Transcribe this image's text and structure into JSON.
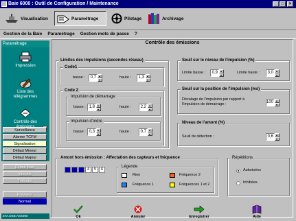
{
  "window": {
    "title": "Baie 6000 : Outil de Configuration / Maintenance"
  },
  "toolbar": {
    "visualisation": "Visualisation",
    "parametrage": "Paramétrage",
    "pilotage": "Pilotage",
    "archivage": "Archivage"
  },
  "menu": {
    "items": [
      "Gestion de la Baie",
      "Paramétrage",
      "Gestion mots de passe",
      "?"
    ]
  },
  "sidebar": {
    "header": "Paramétrage",
    "items": [
      {
        "label": "Impression"
      },
      {
        "label": "Liste des télégrammes"
      },
      {
        "label": "Contrôle des émissions"
      }
    ],
    "buttons": [
      {
        "label": "Surveillance"
      },
      {
        "label": "Alarme TCFM"
      },
      {
        "label": "Signalisation"
      },
      {
        "label": "Défaut Mineur"
      },
      {
        "label": "Défaut Majeur"
      },
      {
        "label": "Défaut Baie"
      },
      {
        "label": "Interdits"
      },
      {
        "label": "Télépilot"
      },
      {
        "label": "Prévision"
      },
      {
        "label": "Normal"
      }
    ],
    "status": "ZTA.DEB.ASS000"
  },
  "main": {
    "title": "Contrôle des émissions",
    "limites": {
      "title": "Limites des impulsions  (secondes réseau)",
      "code1": {
        "title": "Code1",
        "basse_label": "basse :",
        "basse": "0,7",
        "haute_label": "haute :",
        "haute": "1,3"
      },
      "code2": {
        "title": "Code 2",
        "demarrage": {
          "title": "Impulsion de démarrage",
          "basse_label": "basse :",
          "basse": "1,8",
          "haute_label": "haute :",
          "haute": "2,2"
        },
        "ordre": {
          "title": "Impulsion d'ordre",
          "basse_label": "basse :",
          "basse": "0,3",
          "haute_label": "haute :",
          "haute": "0,7"
        }
      }
    },
    "seuil_niveau": {
      "title": "Seuil sur le niveau de l'impulsion  (%)",
      "basse_label": "Limite basse :",
      "basse": "0,9",
      "haute_label": "Limite haute :",
      "haute": "3,0"
    },
    "seuil_position": {
      "title": "Seuil sur la position de l'impulsion (ms)",
      "label": "Décalage de l'impulsion par rapport à l'impulsion de démarrage :",
      "value": "100"
    },
    "niveau_amont": {
      "title": "Niveau de l'amont (%)",
      "label": "Seuil de détection :",
      "value": "0,6"
    },
    "amont": {
      "title": "Amont hors émission : Affectation des capteurs et fréquence",
      "boxes": [
        "1",
        "2",
        "3",
        "4",
        "5",
        "6"
      ],
      "legend": {
        "title": "Légende",
        "items": [
          {
            "label": "Rien",
            "color": "#ffffff"
          },
          {
            "label": "Fréquence 2",
            "color": "#ff6020"
          },
          {
            "label": "Fréquence 1",
            "color": "#2080f0"
          },
          {
            "label": "Fréquences 1 et 2",
            "color": "#ffff00"
          }
        ]
      }
    },
    "repetitions": {
      "title": "Répétitions",
      "options": [
        {
          "label": "Autorisées",
          "checked": true
        },
        {
          "label": "Inhibées",
          "checked": false
        }
      ]
    },
    "actions": {
      "ok": "Ok",
      "annuler": "Annuler",
      "enregistrer": "Enregistrer",
      "aide": "Aide"
    }
  }
}
